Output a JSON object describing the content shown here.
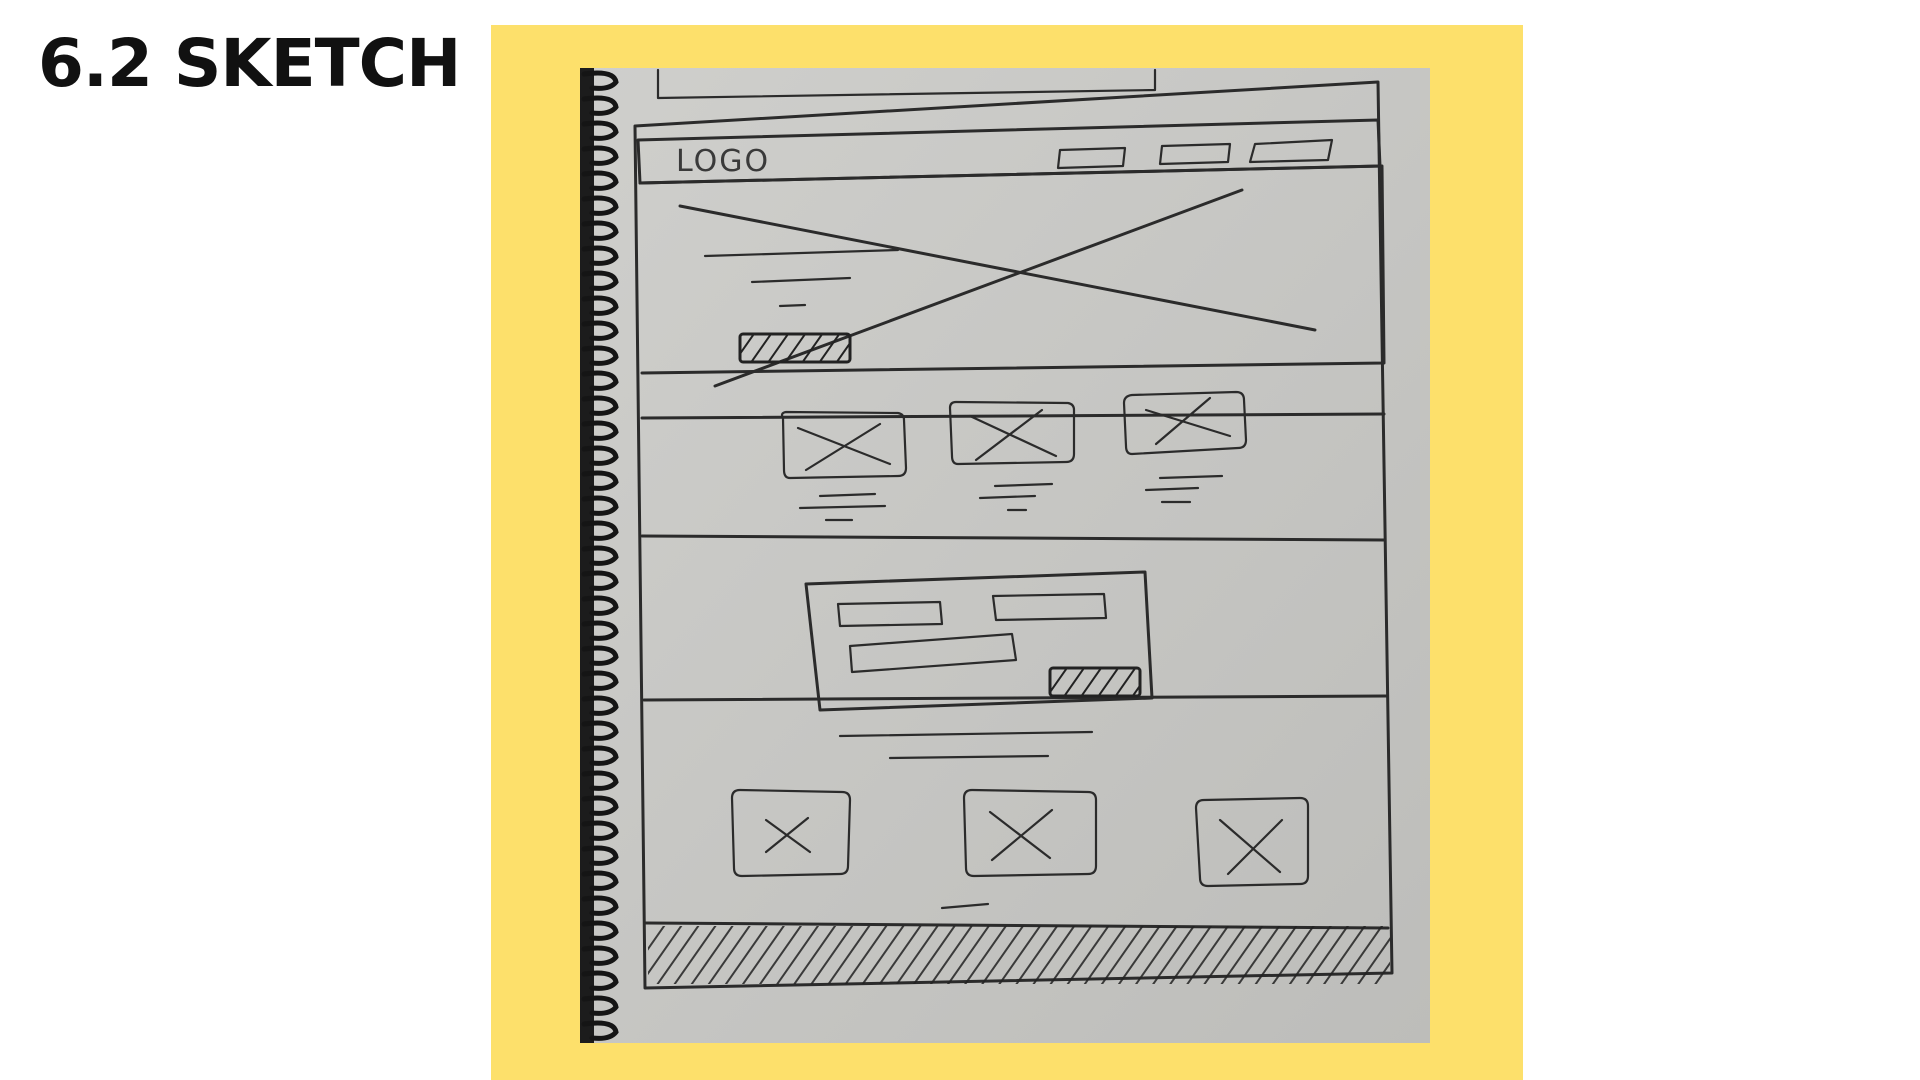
{
  "slide": {
    "title": "6.2 SKETCH"
  },
  "sketch": {
    "logo_label": "LOGO",
    "frame_color": "#fde06b",
    "paper_color": "#c9c9c6",
    "ink_color": "#2b2b2b",
    "sections": [
      "header-with-logo-and-nav",
      "hero-image-with-text-and-button",
      "three-feature-cards",
      "form-panel-with-button",
      "three-gallery-images",
      "footer-hatched"
    ]
  }
}
